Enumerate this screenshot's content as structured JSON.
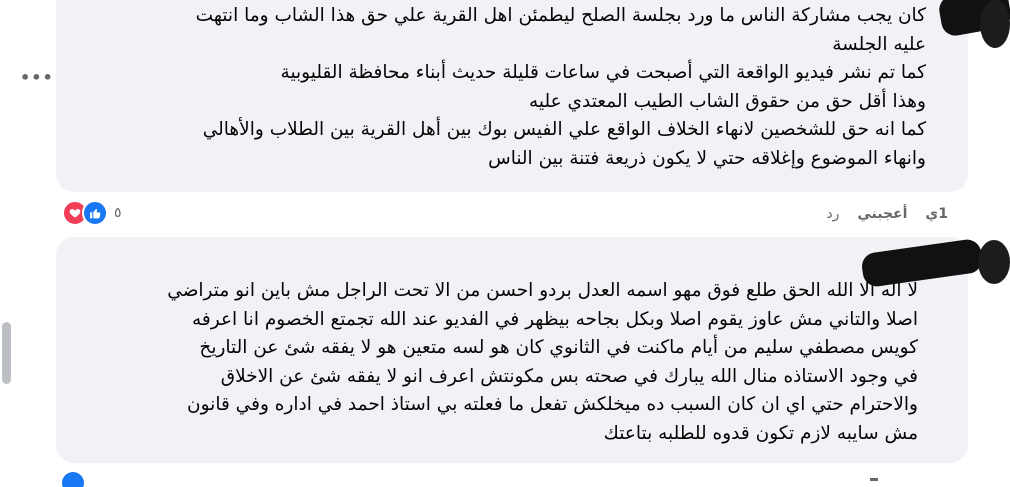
{
  "comment1": {
    "lines": [
      "كان يجب مشاركة الناس ما ورد بجلسة الصلح ليطمئن اهل القرية علي حق هذا الشاب وما انتهت",
      "عليه الجلسة",
      "كما تم نشر فيديو الواقعة التي أصبحت في ساعات قليلة حديث أبناء محافظة القليوبية",
      "وهذا أقل حق من حقوق الشاب الطيب المعتدي عليه",
      "كما انه حق للشخصين لانهاء الخلاف الواقع علي الفيس بوك بين أهل القرية بين الطلاب والأهالي",
      "وانهاء الموضوع وإغلاقه حتي لا يكون ذريعة فتنة بين الناس"
    ],
    "time": "1ي",
    "like_label": "أعجبني",
    "reply_label": "رد",
    "reaction_count": "٥"
  },
  "comment2": {
    "lines": [
      "لا اله الا الله الحق طلع فوق مهو اسمه العدل بردو احسن من الا تحت الراجل مش باين انو متراضي",
      "اصلا والتاني مش عاوز يقوم اصلا وبكل بجاحه بيظهر في الفديو عند الله تجمتع الخصوم انا اعرفه",
      "كويس مصطفي سليم من أيام ماكنت في الثانوي كان هو لسه متعين هو لا يفقه شئ عن التاريخ",
      "في وجود الاستاذه منال الله يبارك في صحته بس مكونتش اعرف انو لا يفقه شئ عن الاخلاق",
      "والاحترام حتي اي ان كان السبب ده ميخلكش تفعل ما فعلته بي استاذ احمد في اداره وفي قانون",
      "مش سايبه لازم تكون قدوه للطلبه بتاعتك"
    ]
  },
  "colors": {
    "bubble": "#f0f2f5",
    "text": "#050505",
    "meta": "#65676b",
    "like_blue": "#1877f2",
    "love_red": "#f33e58"
  },
  "icons": {
    "more": "more-options-icon",
    "like": "like-reaction-icon",
    "love": "love-reaction-icon"
  }
}
